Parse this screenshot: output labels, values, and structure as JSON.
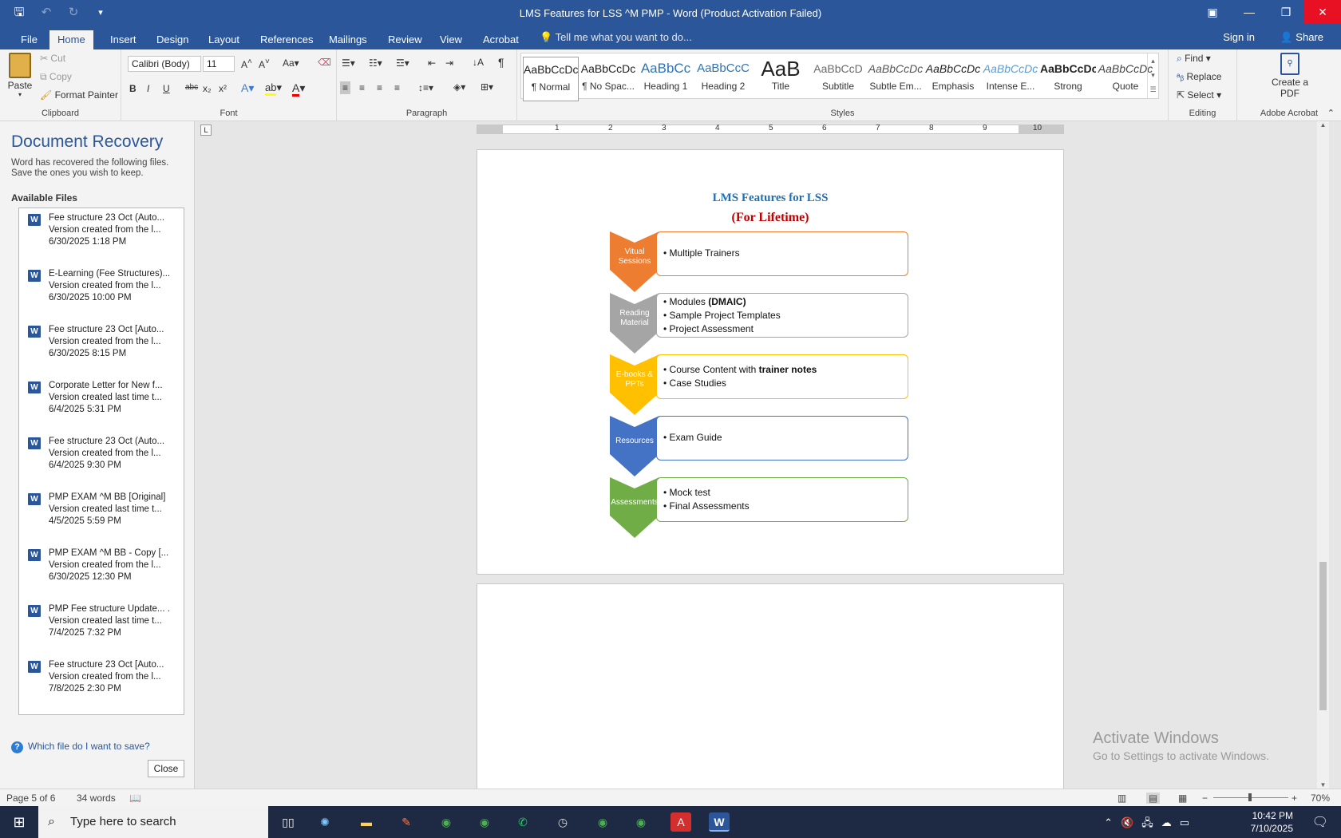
{
  "window": {
    "title": "LMS Features for LSS ^M PMP - Word (Product Activation Failed)",
    "qat": {
      "save_icon": "save-icon",
      "undo_icon": "undo-icon",
      "redo_icon": "redo-icon",
      "more_icon": "customize-icon"
    },
    "controls": {
      "ribbon_options": "ribbon-display-icon",
      "minimize": "minimize-icon",
      "restore": "restore-icon",
      "close": "close-icon"
    }
  },
  "tabs": [
    "File",
    "Home",
    "Insert",
    "Design",
    "Layout",
    "References",
    "Mailings",
    "Review",
    "View",
    "Acrobat"
  ],
  "tell_me": "Tell me what you want to do...",
  "sign_in": "Sign in",
  "share": "Share",
  "ribbon": {
    "clipboard": {
      "paste": "Paste",
      "cut": "Cut",
      "copy": "Copy",
      "format_painter": "Format Painter",
      "label": "Clipboard"
    },
    "font": {
      "family": "Calibri (Body)",
      "size": "11",
      "label": "Font",
      "bold": "B",
      "italic": "I",
      "underline": "U",
      "strike": "abc",
      "subscript": "x₂",
      "superscript": "x²"
    },
    "paragraph": {
      "label": "Paragraph",
      "pilcrow": "¶"
    },
    "styles": {
      "label": "Styles",
      "items": [
        {
          "sample": "AaBbCcDc",
          "name": "¶ Normal"
        },
        {
          "sample": "AaBbCcDc",
          "name": "¶ No Spac..."
        },
        {
          "sample": "AaBbCc",
          "name": "Heading 1"
        },
        {
          "sample": "AaBbCcC",
          "name": "Heading 2"
        },
        {
          "sample": "AaB",
          "name": "Title"
        },
        {
          "sample": "AaBbCcD",
          "name": "Subtitle"
        },
        {
          "sample": "AaBbCcDc",
          "name": "Subtle Em..."
        },
        {
          "sample": "AaBbCcDc",
          "name": "Emphasis"
        },
        {
          "sample": "AaBbCcDc",
          "name": "Intense E..."
        },
        {
          "sample": "AaBbCcDc",
          "name": "Strong"
        },
        {
          "sample": "AaBbCcDc",
          "name": "Quote"
        }
      ]
    },
    "editing": {
      "label": "Editing",
      "find": "Find",
      "replace": "Replace",
      "select": "Select"
    },
    "acrobat": {
      "label": "Adobe Acrobat",
      "create_pdf": "Create a PDF"
    }
  },
  "recovery": {
    "title": "Document Recovery",
    "description": "Word has recovered the following files. Save the ones you wish to keep.",
    "available": "Available Files",
    "files": [
      {
        "name": "Fee structure 23 Oct (Auto...",
        "status": "Version created from the l...",
        "date": "6/30/2025 1:18 PM"
      },
      {
        "name": "E-Learning (Fee Structures)...",
        "status": "Version created from the l...",
        "date": "6/30/2025 10:00 PM"
      },
      {
        "name": "Fee structure 23 Oct  [Auto...",
        "status": "Version created from the l...",
        "date": "6/30/2025 8:15 PM"
      },
      {
        "name": "Corporate Letter for New f...",
        "status": "Version created last time t...",
        "date": "6/4/2025 5:31 PM"
      },
      {
        "name": "Fee structure 23 Oct (Auto...",
        "status": "Version created from the l...",
        "date": "6/4/2025 9:30 PM"
      },
      {
        "name": "PMP EXAM ^M BB  [Original]",
        "status": "Version created last time t...",
        "date": "4/5/2025 5:59 PM"
      },
      {
        "name": "PMP EXAM ^M BB - Copy  [...",
        "status": "Version created from the l...",
        "date": "6/30/2025 12:30 PM"
      },
      {
        "name": "PMP Fee structure Update... .",
        "status": "Version created last time t...",
        "date": "7/4/2025 7:32 PM"
      },
      {
        "name": "Fee structure 23 Oct  [Auto...",
        "status": "Version created from the l...",
        "date": "7/8/2025 2:30 PM"
      }
    ],
    "which_link": "Which file do I want to save?",
    "close": "Close"
  },
  "ruler": {
    "numbers": [
      "1",
      "2",
      "3",
      "4",
      "5",
      "6",
      "7",
      "8",
      "9",
      "10"
    ]
  },
  "document": {
    "title": "LMS Features for LSS",
    "subtitle": "(For Lifetime)",
    "rows": [
      {
        "label": "Vitual Sessions",
        "color": "#ed7d31",
        "items": [
          {
            "text": "Multiple Trainers",
            "bold": ""
          }
        ]
      },
      {
        "label": "Reading Material",
        "color": "#a5a5a5",
        "items": [
          {
            "text": "Modules ",
            "bold": "(DMAIC)"
          },
          {
            "text": "Sample Project Templates",
            "bold": ""
          },
          {
            "text": "Project Assessment",
            "bold": ""
          }
        ]
      },
      {
        "label": "E-books & PPTs",
        "color": "#ffc000",
        "items": [
          {
            "text": "Course Content with ",
            "bold": "trainer notes"
          },
          {
            "text": "Case Studies",
            "bold": ""
          }
        ]
      },
      {
        "label": "Resources",
        "color": "#4472c4",
        "items": [
          {
            "text": "Exam Guide",
            "bold": ""
          }
        ]
      },
      {
        "label": "Assessments",
        "color": "#70ad47",
        "items": [
          {
            "text": "Mock test",
            "bold": ""
          },
          {
            "text": "Final Assessments",
            "bold": ""
          }
        ]
      }
    ]
  },
  "watermark": {
    "line1": "Activate Windows",
    "line2": "Go to Settings to activate Windows."
  },
  "status": {
    "page": "Page 5 of 6",
    "words": "34 words",
    "zoom": "70%"
  },
  "taskbar": {
    "search_placeholder": "Type here to search",
    "time": "10:42 PM",
    "date": "7/10/2025"
  }
}
